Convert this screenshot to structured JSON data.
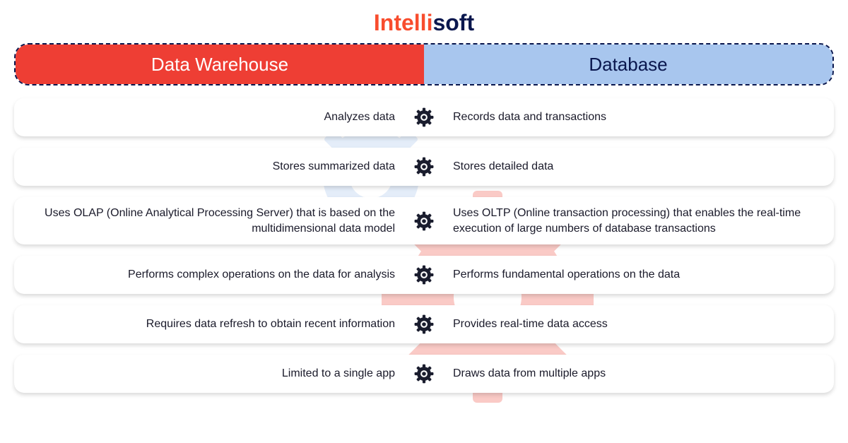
{
  "logo": {
    "part1": "Intelli",
    "part2": "soft"
  },
  "header": {
    "left": "Data Warehouse",
    "right": "Database"
  },
  "colors": {
    "brand_red": "#f84d2e",
    "brand_navy": "#0a174e",
    "header_red": "#ee3e34",
    "header_blue": "#a8c6ee",
    "gear_icon": "#1a1d2e"
  },
  "rows": [
    {
      "left": "Analyzes data",
      "right": "Records data and transactions"
    },
    {
      "left": "Stores summarized data",
      "right": "Stores detailed data"
    },
    {
      "left": "Uses OLAP (Online Analytical Processing Server) that is based on the multidimensional data model",
      "right": "Uses OLTP (Online transaction processing) that enables the real-time execution of large numbers of database transactions"
    },
    {
      "left": "Performs complex operations on the data for analysis",
      "right": "Performs fundamental operations on the data"
    },
    {
      "left": "Requires data refresh to obtain recent information",
      "right": "Provides real-time data access"
    },
    {
      "left": "Limited to a single app",
      "right": "Draws data from multiple apps"
    }
  ]
}
